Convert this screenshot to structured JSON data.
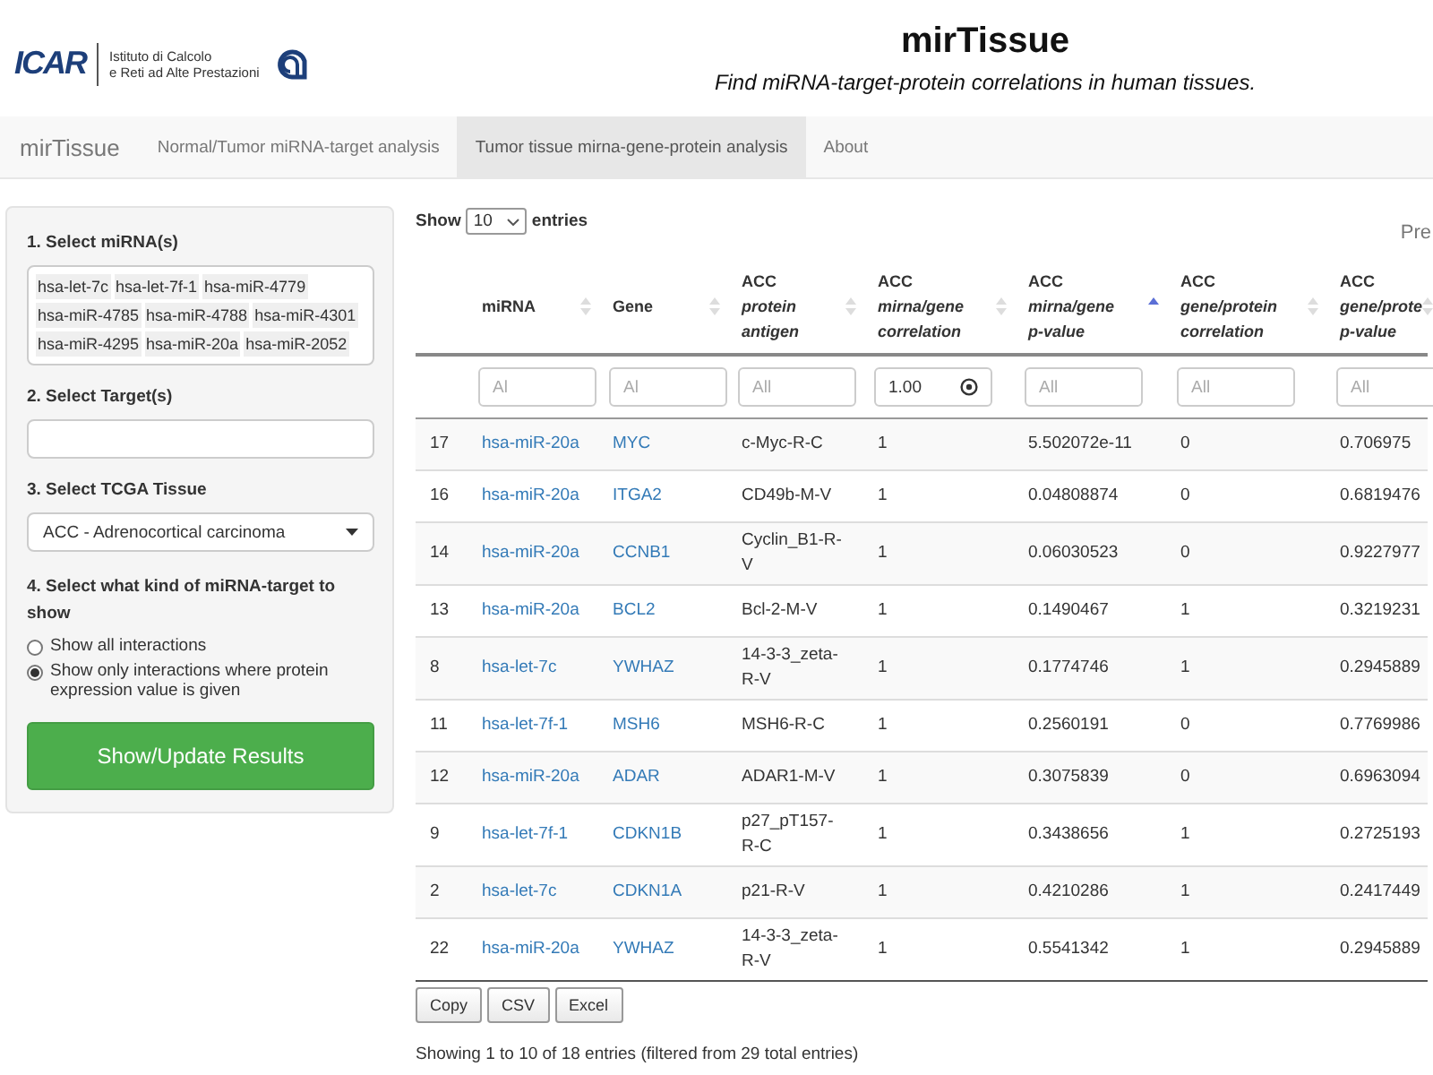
{
  "header": {
    "logo": {
      "text": "ICAR",
      "institute": [
        "Istituto di Calcolo",
        "e Reti ad Alte Prestazioni"
      ]
    },
    "title": "mirTissue",
    "subtitle": "Find miRNA-target-protein correlations in human tissues."
  },
  "navbar": {
    "brand": "mirTissue",
    "tabs": [
      {
        "label": "Normal/Tumor miRNA-target analysis",
        "selected": false
      },
      {
        "label": "Tumor tissue mirna-gene-protein analysis",
        "selected": true
      },
      {
        "label": "About",
        "selected": false
      }
    ]
  },
  "sidebar": {
    "mirna": {
      "label": "1. Select miRNA(s)",
      "tags": [
        "hsa-let-7c",
        "hsa-let-7f-1",
        "hsa-miR-4779",
        "hsa-miR-4785",
        "hsa-miR-4788",
        "hsa-miR-4301",
        "hsa-miR-4295",
        "hsa-miR-20a",
        "hsa-miR-2052"
      ]
    },
    "target": {
      "label": "2. Select Target(s)"
    },
    "tissue": {
      "label": "3. Select TCGA Tissue",
      "value": "ACC - Adrenocortical carcinoma"
    },
    "kind": {
      "label": "4. Select what kind of miRNA-target to show",
      "options": [
        {
          "label": "Show all interactions",
          "selected": false
        },
        {
          "label": "Show only interactions where protein expression value is given",
          "selected": true
        }
      ]
    },
    "submit": "Show/Update Results"
  },
  "table": {
    "length": {
      "before": "Show",
      "value": "10",
      "after": "entries"
    },
    "pager": "Pre",
    "columns": [
      {
        "lines": [
          "miRNA"
        ],
        "sorted": false
      },
      {
        "lines": [
          "Gene"
        ],
        "sorted": false
      },
      {
        "lines": [
          "ACC",
          "protein",
          "antigen"
        ],
        "sorted": false
      },
      {
        "lines": [
          "ACC",
          "mirna/gene",
          "correlation"
        ],
        "sorted": false
      },
      {
        "lines": [
          "ACC",
          "mirna/gene",
          "p-value"
        ],
        "sorted": true
      },
      {
        "lines": [
          "ACC",
          "gene/protein",
          "correlation"
        ],
        "sorted": false
      },
      {
        "lines": [
          "ACC",
          "gene/prote",
          "p-value"
        ],
        "sorted": false
      }
    ],
    "filters": [
      {
        "placeholder": "Al"
      },
      {
        "placeholder": "Al"
      },
      {
        "placeholder": "All"
      },
      {
        "value": "1.00"
      },
      {
        "placeholder": "All"
      },
      {
        "placeholder": "All"
      },
      {
        "placeholder": "All"
      }
    ],
    "rows": [
      {
        "n": "17",
        "mirna": "hsa-miR-20a",
        "gene": "MYC",
        "antigen": "c-Myc-R-C",
        "corr": "1",
        "pval": "5.502072e-11",
        "gp_corr": "0",
        "gp_pval": "0.706975"
      },
      {
        "n": "16",
        "mirna": "hsa-miR-20a",
        "gene": "ITGA2",
        "antigen": "CD49b-M-V",
        "corr": "1",
        "pval": "0.04808874",
        "gp_corr": "0",
        "gp_pval": "0.6819476"
      },
      {
        "n": "14",
        "mirna": "hsa-miR-20a",
        "gene": "CCNB1",
        "antigen": "Cyclin_B1-R-V",
        "corr": "1",
        "pval": "0.06030523",
        "gp_corr": "0",
        "gp_pval": "0.9227977"
      },
      {
        "n": "13",
        "mirna": "hsa-miR-20a",
        "gene": "BCL2",
        "antigen": "Bcl-2-M-V",
        "corr": "1",
        "pval": "0.1490467",
        "gp_corr": "1",
        "gp_pval": "0.3219231"
      },
      {
        "n": "8",
        "mirna": "hsa-let-7c",
        "gene": "YWHAZ",
        "antigen": "14-3-3_zeta-R-V",
        "corr": "1",
        "pval": "0.1774746",
        "gp_corr": "1",
        "gp_pval": "0.2945889"
      },
      {
        "n": "11",
        "mirna": "hsa-let-7f-1",
        "gene": "MSH6",
        "antigen": "MSH6-R-C",
        "corr": "1",
        "pval": "0.2560191",
        "gp_corr": "0",
        "gp_pval": "0.7769986"
      },
      {
        "n": "12",
        "mirna": "hsa-miR-20a",
        "gene": "ADAR",
        "antigen": "ADAR1-M-V",
        "corr": "1",
        "pval": "0.3075839",
        "gp_corr": "0",
        "gp_pval": "0.6963094"
      },
      {
        "n": "9",
        "mirna": "hsa-let-7f-1",
        "gene": "CDKN1B",
        "antigen": "p27_pT157-R-C",
        "corr": "1",
        "pval": "0.3438656",
        "gp_corr": "1",
        "gp_pval": "0.2725193"
      },
      {
        "n": "2",
        "mirna": "hsa-let-7c",
        "gene": "CDKN1A",
        "antigen": "p21-R-V",
        "corr": "1",
        "pval": "0.4210286",
        "gp_corr": "1",
        "gp_pval": "0.2417449"
      },
      {
        "n": "22",
        "mirna": "hsa-miR-20a",
        "gene": "YWHAZ",
        "antigen": "14-3-3_zeta-R-V",
        "corr": "1",
        "pval": "0.5541342",
        "gp_corr": "1",
        "gp_pval": "0.2945889"
      }
    ],
    "buttons": [
      "Copy",
      "CSV",
      "Excel"
    ],
    "info": "Showing 1 to 10 of 18 entries (filtered from 29 total entries)"
  }
}
